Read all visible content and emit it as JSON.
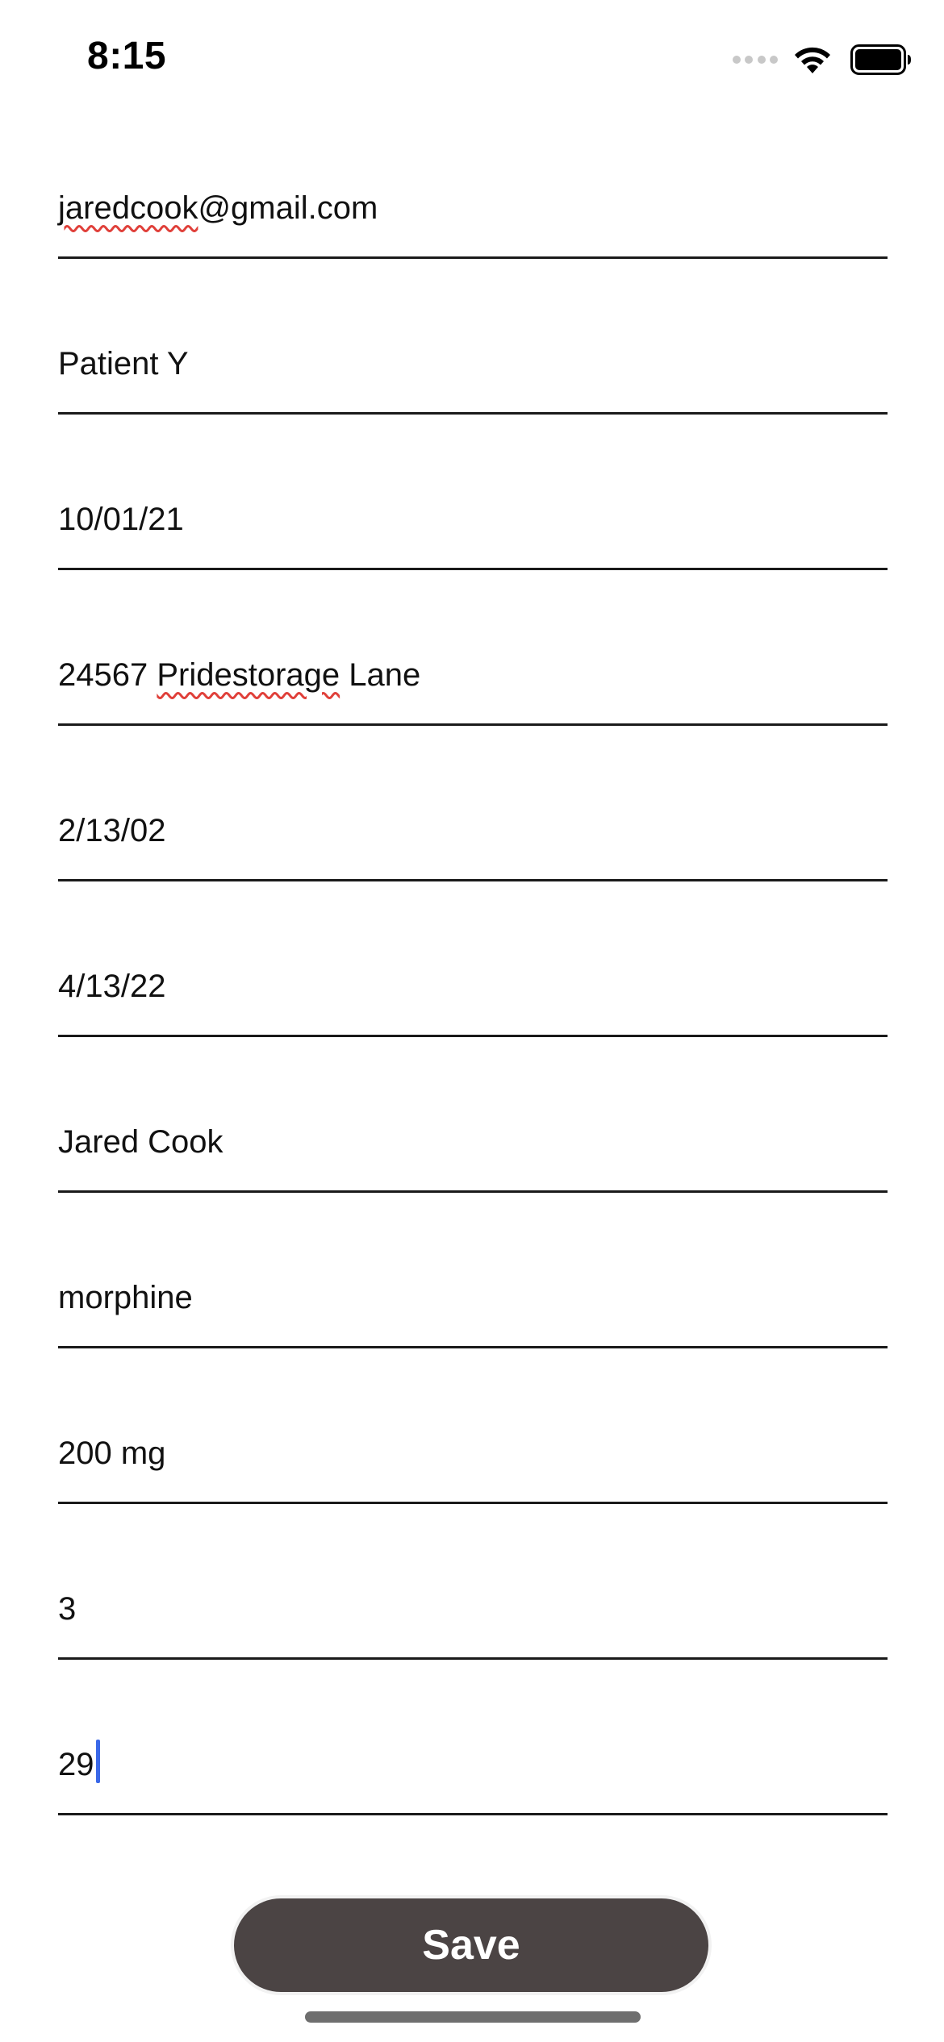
{
  "status_bar": {
    "time": "8:15"
  },
  "form": {
    "fields": [
      {
        "name": "email",
        "value": "jaredcook@gmail.com"
      },
      {
        "name": "patient",
        "value": "Patient Y"
      },
      {
        "name": "date-1",
        "value": "10/01/21"
      },
      {
        "name": "address",
        "value": "24567 Pridestorage Lane"
      },
      {
        "name": "date-2",
        "value": "2/13/02"
      },
      {
        "name": "date-3",
        "value": "4/13/22"
      },
      {
        "name": "name",
        "value": "Jared Cook"
      },
      {
        "name": "medication",
        "value": "morphine"
      },
      {
        "name": "dosage",
        "value": "200 mg"
      },
      {
        "name": "count",
        "value": "3"
      },
      {
        "name": "number",
        "value": "29"
      }
    ],
    "email_parts": {
      "misspelled": "jaredcook",
      "rest": "@gmail.com"
    },
    "address_parts": {
      "before": "24567 ",
      "misspelled": "Pridestorage",
      "after": " Lane"
    }
  },
  "save_button": {
    "label": "Save",
    "background": "#4b4444",
    "text_color": "#ffffff"
  },
  "colors": {
    "caret": "#3a68e8",
    "spellcheck_underline": "#e0403a"
  },
  "icons": [
    "cellular-signal-icon",
    "wifi-icon",
    "battery-icon"
  ]
}
